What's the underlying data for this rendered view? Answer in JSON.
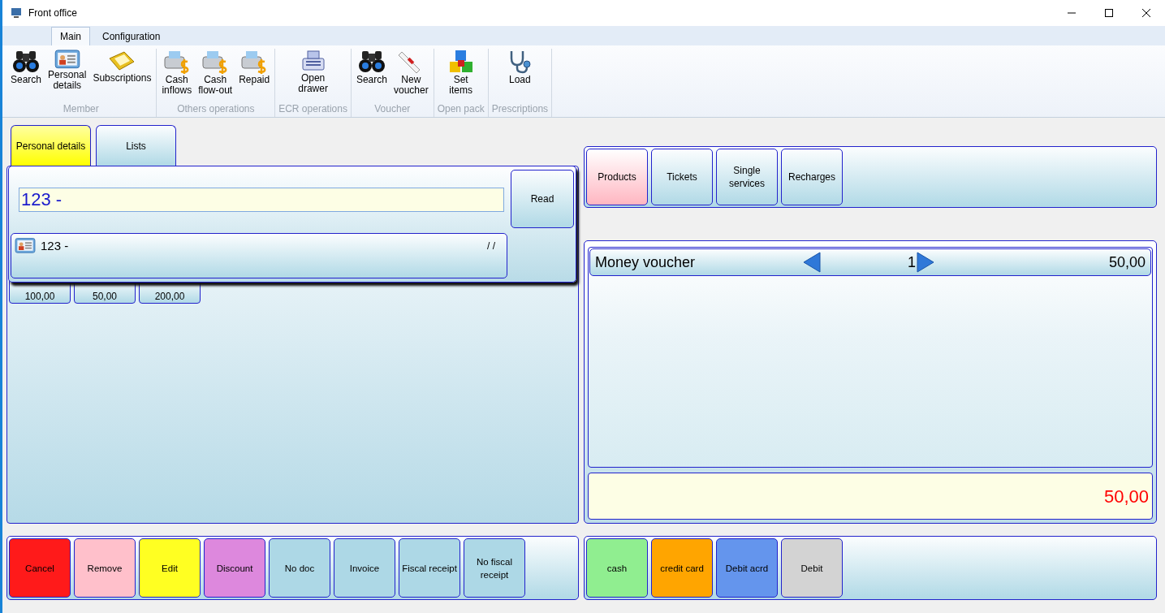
{
  "window": {
    "title": "Front office"
  },
  "ribbon_tabs": [
    {
      "label": "Main",
      "selected": true
    },
    {
      "label": "Configuration",
      "selected": false
    }
  ],
  "ribbon_groups": [
    {
      "label": "Member",
      "items": [
        "Search",
        "Personal details",
        "Subscriptions"
      ]
    },
    {
      "label": "Others operations",
      "items": [
        "Cash inflows",
        "Cash flow-out",
        "Repaid"
      ]
    },
    {
      "label": "ECR operations",
      "items": [
        "Open drawer"
      ]
    },
    {
      "label": "Voucher",
      "items": [
        "Search",
        "New voucher"
      ]
    },
    {
      "label": "Open pack",
      "items": [
        "Set items"
      ]
    },
    {
      "label": "Prescriptions",
      "items": [
        "Load"
      ]
    }
  ],
  "left_tabs": [
    {
      "label": "Personal details",
      "selected": true
    },
    {
      "label": "Lists",
      "selected": false
    }
  ],
  "member_search": {
    "value": "123 -",
    "read_button": "Read",
    "result": {
      "name": "123 -",
      "date": "/ /"
    }
  },
  "amounts": [
    "100,00",
    "50,00",
    "200,00"
  ],
  "categories": [
    {
      "label": "Products",
      "selected": true
    },
    {
      "label": "Tickets",
      "selected": false
    },
    {
      "label": "Single services",
      "selected": false
    },
    {
      "label": "Recharges",
      "selected": false
    }
  ],
  "cart": [
    {
      "name": "Money voucher",
      "quantity": "1",
      "price": "50,00"
    }
  ],
  "total": "50,00",
  "actions": [
    {
      "label": "Cancel",
      "color": "#ff1a1a"
    },
    {
      "label": "Remove",
      "color": "#ffc0cb"
    },
    {
      "label": "Edit",
      "color": "#ffff22"
    },
    {
      "label": "Discount",
      "color": "#dd88dd"
    },
    {
      "label": "No doc",
      "color": "#add8e6"
    },
    {
      "label": "Invoice",
      "color": "#add8e6"
    },
    {
      "label": "Fiscal receipt",
      "color": "#add8e6"
    },
    {
      "label": "No fiscal receipt",
      "color": "#add8e6"
    }
  ],
  "payments": [
    {
      "label": "cash",
      "color": "#90ee90"
    },
    {
      "label": "credit card",
      "color": "#ffa500"
    },
    {
      "label": "Debit acrd",
      "color": "#6495ed"
    },
    {
      "label": "Debit",
      "color": "#d3d3d3"
    }
  ]
}
